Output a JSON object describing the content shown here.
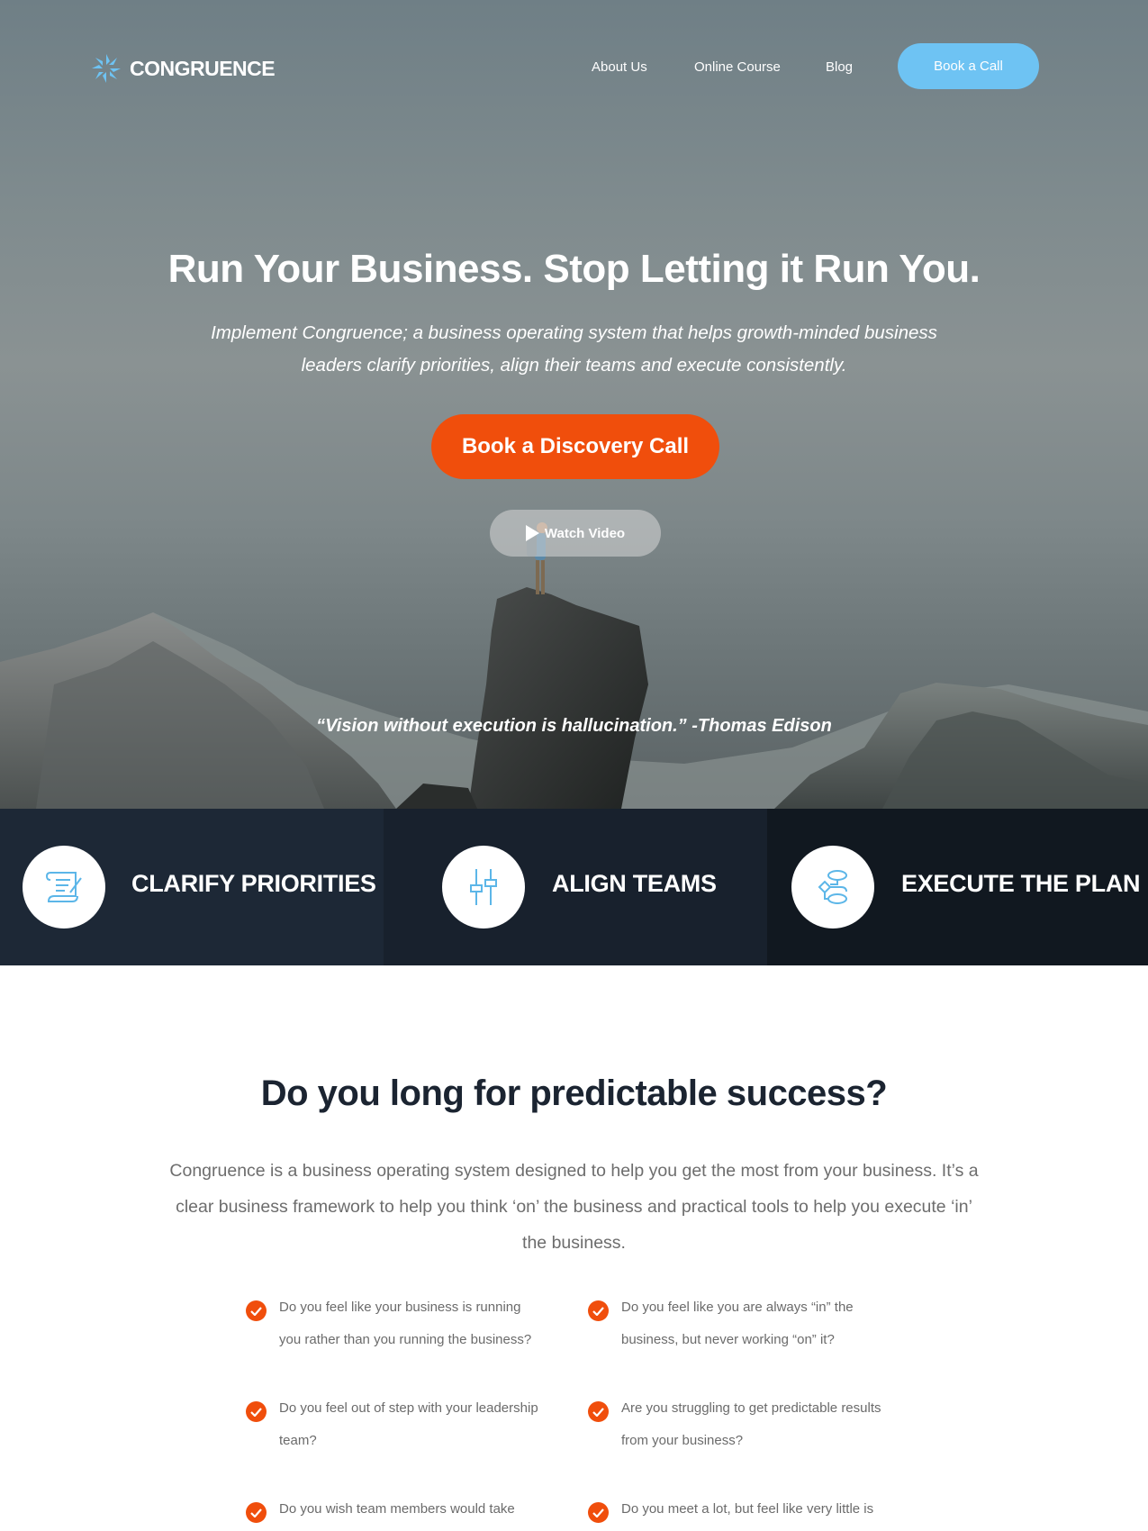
{
  "brand": {
    "name": "CONGRUENCE"
  },
  "nav": {
    "links": [
      "About Us",
      "Online Course",
      "Blog"
    ],
    "cta": "Book a Call"
  },
  "hero": {
    "title": "Run Your Business. Stop Letting it Run You.",
    "subtitle": "Implement Congruence; a business operating system that helps growth-minded business leaders clarify priorities, align their teams and execute consistently.",
    "cta": "Book a Discovery Call",
    "video": "Watch Video",
    "quote": "“Vision without execution is hallucination.” -Thomas Edison"
  },
  "pillars": [
    {
      "label": "CLARIFY PRIORITIES",
      "icon": "scroll-icon"
    },
    {
      "label": "ALIGN TEAMS",
      "icon": "sliders-icon"
    },
    {
      "label": "EXECUTE THE PLAN",
      "icon": "flowchart-icon"
    }
  ],
  "section": {
    "title": "Do you long for predictable success?",
    "text": "Congruence is a business operating system designed to help you get the most from your business. It’s a clear business framework to help you think ‘on’ the business and practical tools to help you execute ‘in’ the business.",
    "questions": [
      "Do you feel like your business is running you rather than you running the business?",
      "Do you feel like you are always “in” the business, but never working “on” it?",
      "Do you feel out of step with your leadership team?",
      "Are you struggling to get predictable results from your business?",
      "Do you wish team members would take",
      "Do you meet a lot, but feel like very little is"
    ]
  },
  "colors": {
    "accent_orange": "#f04e0c",
    "accent_blue": "#6ec3f3",
    "navy": "#1d2836"
  }
}
